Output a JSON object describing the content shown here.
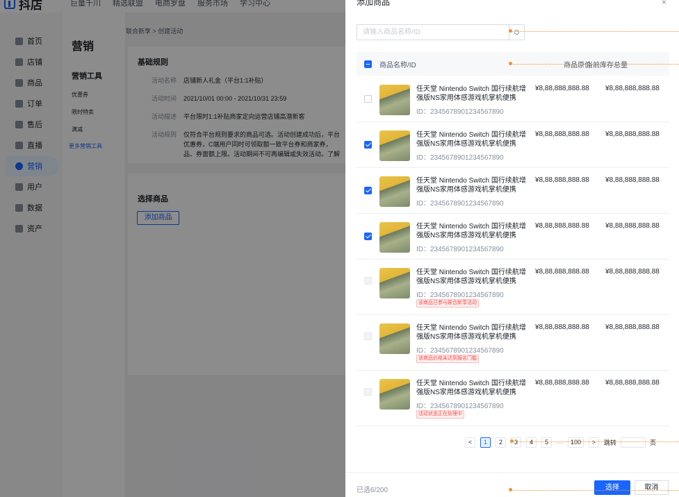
{
  "app": {
    "brand": "抖店"
  },
  "topnav": [
    "巨量千川",
    "精选联盟",
    "电商罗盘",
    "服务市场",
    "学习中心"
  ],
  "sidebar": [
    "首页",
    "店铺",
    "商品",
    "订单",
    "售后",
    "直播",
    "营销",
    "用户",
    "数据",
    "资产"
  ],
  "submenu": {
    "title": "营销",
    "group": "营销工具",
    "items": [
      "优惠券",
      "限时特卖",
      "满减"
    ],
    "more": "更多营销工具"
  },
  "breadcrumb": "联合新享 > 创建活动",
  "basic": {
    "title": "基础规则",
    "rules": [
      {
        "k": "活动名称",
        "v": "店铺新人礼金（平台1:1补贴）"
      },
      {
        "k": "活动时间",
        "v": "2021/10/01 00:00 - 2021/10/31 23:59"
      },
      {
        "k": "活动描述",
        "v": "平台限时1:1补贴商家定向运营店铺高潜新客"
      },
      {
        "k": "活动规则",
        "v": "仅符合平台规则要求的商品可选。活动创建成功后，平台优惠券，C端用户同时可领取额一致平台券和商家券，品、券面额上限。活动期间不可再编辑或失效活动。了解"
      }
    ]
  },
  "select": {
    "title": "选择商品",
    "add": "添加商品"
  },
  "drawer": {
    "title": "添加商品",
    "close": "×",
    "search_placeholder": "请输入商品名称/ID",
    "cols": {
      "name": "商品名称/ID",
      "price": "商品原价",
      "stock": "当前库存总量"
    },
    "rows": [
      {
        "name": "任天堂 Nintendo Switch 国行续航增强版NS家用体感游戏机掌机便携",
        "id": "ID：2345678901234567890",
        "price": "¥8,88,888,888.88",
        "stock": "¥8,88,888,888.88",
        "checked": "off",
        "tag": ""
      },
      {
        "name": "任天堂 Nintendo Switch 国行续航增强版NS家用体感游戏机掌机便携",
        "id": "ID：2345678901234567890",
        "price": "¥8,88,888,888.88",
        "stock": "¥8,88,888,888.88",
        "checked": "on",
        "tag": ""
      },
      {
        "name": "任天堂 Nintendo Switch 国行续航增强版NS家用体感游戏机掌机便携",
        "id": "ID：2345678901234567890",
        "price": "¥8,88,888,888.88",
        "stock": "¥8,88,888,888.88",
        "checked": "on",
        "tag": ""
      },
      {
        "name": "任天堂 Nintendo Switch 国行续航增强版NS家用体感游戏机掌机便携",
        "id": "ID：2345678901234567890",
        "price": "¥8,88,888,888.88",
        "stock": "¥8,88,888,888.88",
        "checked": "on",
        "tag": ""
      },
      {
        "name": "任天堂 Nintendo Switch 国行续航增强版NS家用体感游戏机掌机便携",
        "id": "ID：2345678901234567890",
        "price": "¥8,88,888,888.88",
        "stock": "¥8,88,888,888.88",
        "checked": "dis",
        "tag": "该商品已参与联合新享活动"
      },
      {
        "name": "任天堂 Nintendo Switch 国行续航增强版NS家用体感游戏机掌机便携",
        "id": "ID：2345678901234567890",
        "price": "¥8,88,888,888.88",
        "stock": "¥8,88,888,888.88",
        "checked": "dis",
        "tag": "该商品价格未达到报名门槛"
      },
      {
        "name": "任天堂 Nintendo Switch 国行续航增强版NS家用体感游戏机掌机便携",
        "id": "ID：2345678901234567890",
        "price": "¥8,88,888,888.88",
        "stock": "¥8,88,888,888.88",
        "checked": "dis",
        "tag": "活动状态正在处理中"
      }
    ],
    "pager": {
      "prev": "<",
      "pages": [
        "1",
        "2",
        "3",
        "4",
        "5"
      ],
      "current": "1",
      "ellipsis": "···",
      "last": "100",
      "next": ">",
      "jump": "跳转",
      "unit": "页"
    },
    "footer": {
      "count": "已选6/200",
      "select": "选择",
      "cancel": "取消"
    }
  },
  "colors": {
    "primary": "#1966ff",
    "annotation": "#f0932b",
    "danger": "#f54a45"
  }
}
